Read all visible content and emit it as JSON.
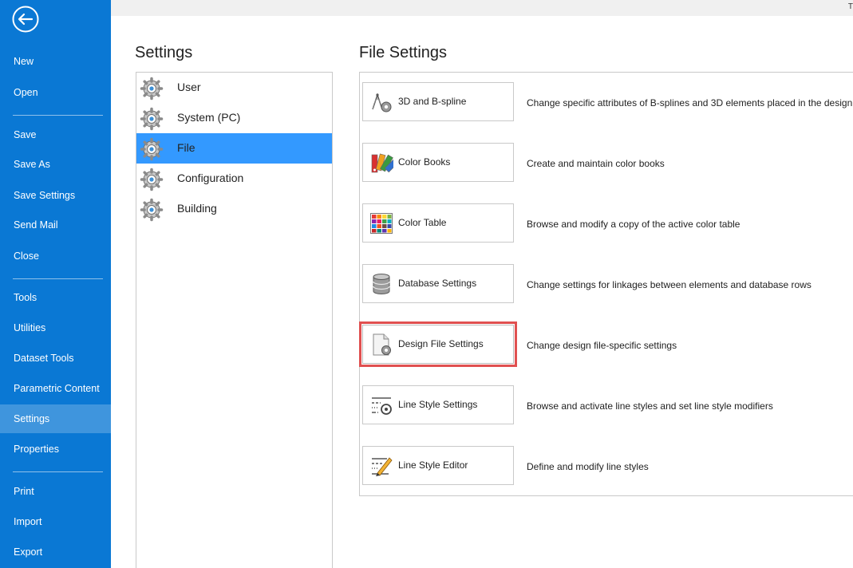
{
  "sidebar": {
    "items": [
      {
        "label": "New"
      },
      {
        "label": "Open"
      },
      {
        "label": "Save"
      },
      {
        "label": "Save As"
      },
      {
        "label": "Save Settings"
      },
      {
        "label": "Send Mail"
      },
      {
        "label": "Close"
      },
      {
        "label": "Tools"
      },
      {
        "label": "Utilities"
      },
      {
        "label": "Dataset Tools"
      },
      {
        "label": "Parametric Content"
      },
      {
        "label": "Settings"
      },
      {
        "label": "Properties"
      },
      {
        "label": "Print"
      },
      {
        "label": "Import"
      },
      {
        "label": "Export"
      }
    ],
    "active": "Settings"
  },
  "topbar": {
    "text": "T"
  },
  "settings": {
    "title": "Settings",
    "categories": [
      {
        "label": "User"
      },
      {
        "label": "System (PC)"
      },
      {
        "label": "File"
      },
      {
        "label": "Configuration"
      },
      {
        "label": "Building"
      }
    ],
    "selected": "File"
  },
  "file_settings": {
    "title": "File Settings",
    "items": [
      {
        "label": "3D and B-spline",
        "icon": "bspline-gear-icon",
        "description": "Change specific attributes of B-splines and 3D elements placed in the design"
      },
      {
        "label": "Color Books",
        "icon": "color-books-icon",
        "description": "Create and maintain color books"
      },
      {
        "label": "Color Table",
        "icon": "color-table-icon",
        "description": "Browse and modify a copy of the active color table"
      },
      {
        "label": "Database Settings",
        "icon": "database-icon",
        "description": "Change settings for linkages between elements and database rows"
      },
      {
        "label": "Design File Settings",
        "icon": "design-file-gear-icon",
        "description": "Change design file-specific settings"
      },
      {
        "label": "Line Style Settings",
        "icon": "line-style-gear-icon",
        "description": "Browse and activate line styles and set line style modifiers"
      },
      {
        "label": "Line Style Editor",
        "icon": "line-style-pencil-icon",
        "description": "Define and modify line styles"
      }
    ],
    "highlighted": "Design File Settings"
  },
  "colors": {
    "sidebar": "#0a78d4",
    "sidebar_active": "#3f95dd",
    "selection": "#3399ff",
    "highlight": "#e05050"
  }
}
